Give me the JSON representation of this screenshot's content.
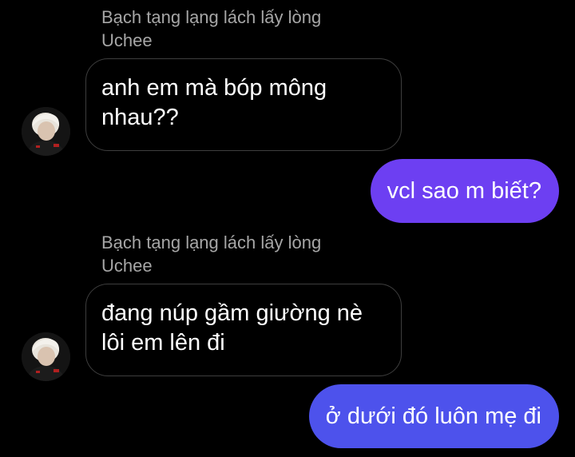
{
  "conversation": {
    "messages": [
      {
        "sender_name": "Bạch tạng lạng lách lấy lòng",
        "sender_name_line2": "Uchee",
        "text_line1": "anh em mà bóp mông",
        "text_line2": "nhau??"
      },
      {
        "text": "vcl sao m biết?",
        "bubble_color": "#6d3ff2"
      },
      {
        "sender_name": "Bạch tạng lạng lách lấy lòng",
        "sender_name_line2": "Uchee",
        "text_line1": "đang núp gầm giường nè",
        "text_line2": "lôi em lên đi"
      },
      {
        "text": "ở dưới đó luôn mẹ đi",
        "bubble_color": "#4d52ec"
      }
    ]
  },
  "colors": {
    "background": "#000000",
    "sender_name": "#a6a6a6",
    "incoming_border": "#3e3e3e",
    "outgoing_top": "#6d3ff2",
    "outgoing_bottom": "#4d52ec"
  },
  "icons": {
    "avatar": "profile-photo-avatar"
  }
}
